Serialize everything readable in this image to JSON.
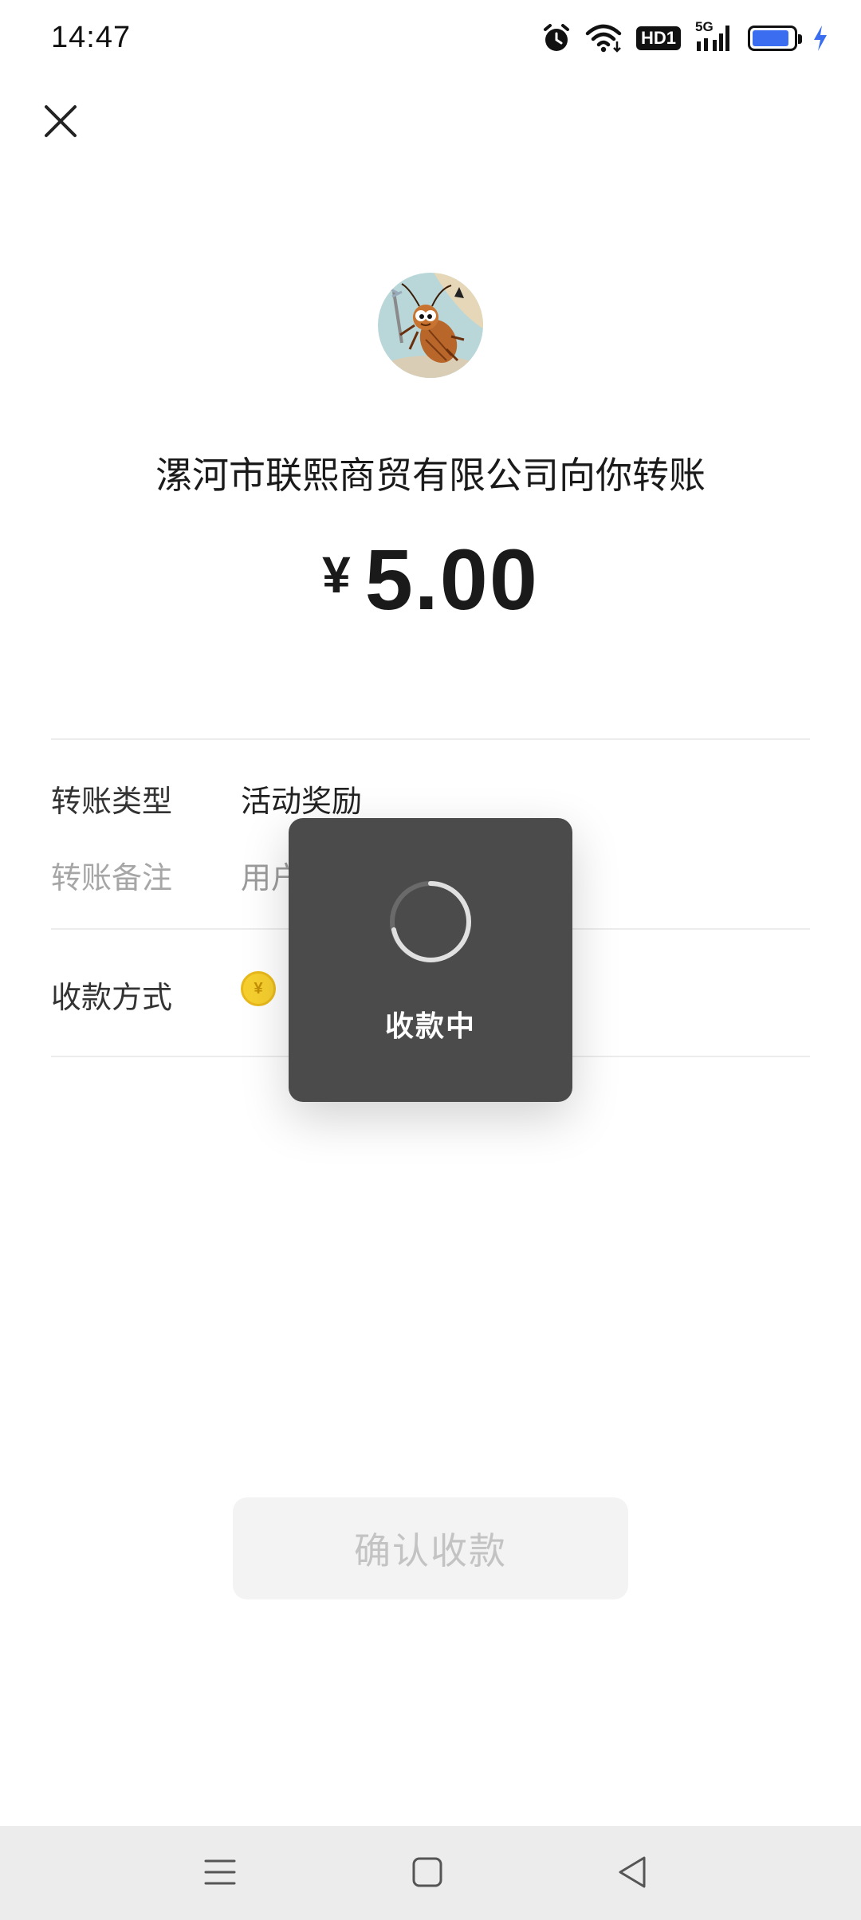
{
  "status_bar": {
    "time": "14:47",
    "hd_label": "HD1",
    "network_label": "5G",
    "battery_level_percent": 90,
    "battery_color": "#3a6df0",
    "charging_color": "#3a6df0"
  },
  "header": {
    "close_icon": "close-icon"
  },
  "transfer": {
    "title": "漯河市联熙商贸有限公司向你转账",
    "currency_symbol": "¥",
    "amount": "5.00"
  },
  "details": {
    "type_label": "转账类型",
    "type_value": "活动奖励",
    "note_label": "转账备注",
    "note_value": "用户",
    "method_label": "收款方式",
    "method_icon": "coin-icon",
    "coin_symbol": "¥"
  },
  "toast": {
    "message": "收款中",
    "icon": "loading-spinner-icon"
  },
  "actions": {
    "confirm_label": "确认收款"
  },
  "nav_bar": {
    "menu_icon": "menu-icon",
    "home_icon": "home-square-icon",
    "back_icon": "back-triangle-icon"
  }
}
